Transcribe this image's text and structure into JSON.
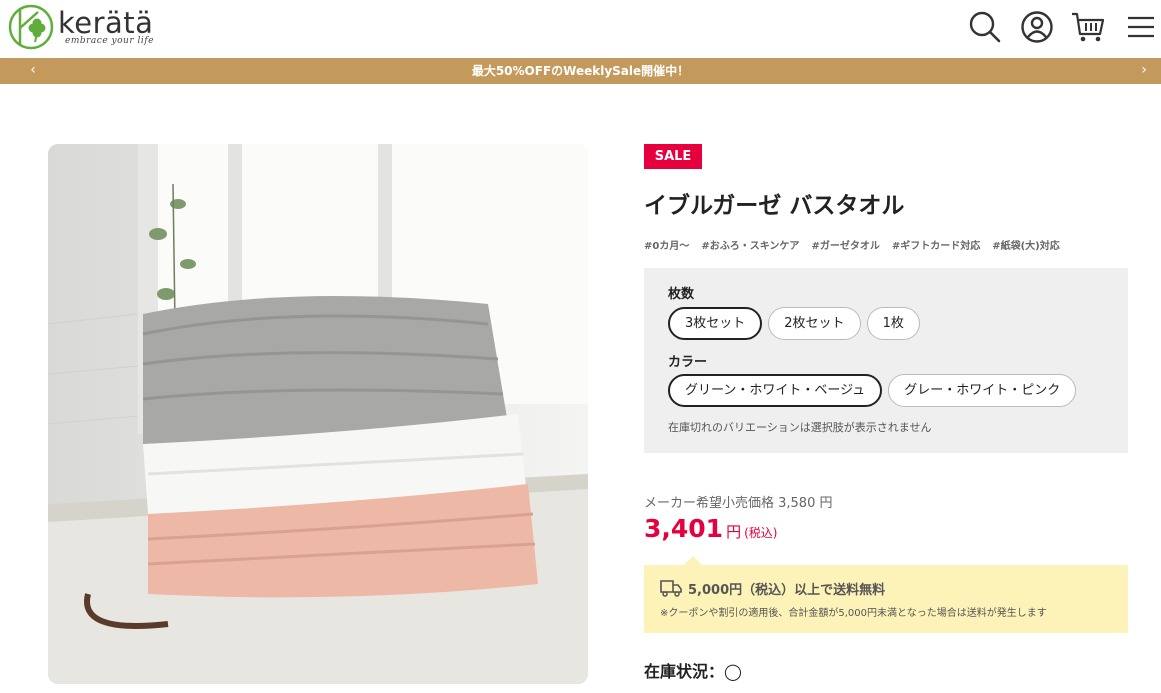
{
  "header": {
    "logo_text": "kerätä",
    "logo_tagline": "embrace your life",
    "icons": [
      "search-icon",
      "account-icon",
      "cart-icon",
      "menu-icon"
    ]
  },
  "announcement": {
    "text": "最大50%OFFのWeeklySale開催中！",
    "prev": "‹",
    "next": "›",
    "background": "#c49a5c"
  },
  "product": {
    "badge": "SALE",
    "title": "イブルガーゼ バスタオル",
    "tags": [
      "#0カ月〜",
      "#おふろ・スキンケア",
      "#ガーゼタオル",
      "#ギフトカード対応",
      "#紙袋(大)対応"
    ],
    "variants": {
      "quantity_label": "枚数",
      "quantity_options": [
        "3枚セット",
        "2枚セット",
        "1枚"
      ],
      "quantity_selected": "3枚セット",
      "color_label": "カラー",
      "color_options": [
        "グリーン・ホワイト・ベージュ",
        "グレー・ホワイト・ピンク"
      ],
      "color_selected": "グリーン・ホワイト・ベージュ",
      "note": "在庫切れのバリエーションは選択肢が表示されません"
    },
    "msrp": "メーカー希望小売価格 3,580 円",
    "price": "3,401",
    "price_currency": "円",
    "price_tax": "(税込)",
    "shipping_title": "5,000円（税込）以上で送料無料",
    "shipping_note": "※クーポンや割引の適用後、合計金額が5,000円未満となった場合は送料が発生します",
    "stock_label": "在庫状況：",
    "stock_status": "◯"
  },
  "colors": {
    "accent": "#e6003e",
    "brand_green": "#5fae3a",
    "shipping_bg": "#fdf3b8"
  }
}
